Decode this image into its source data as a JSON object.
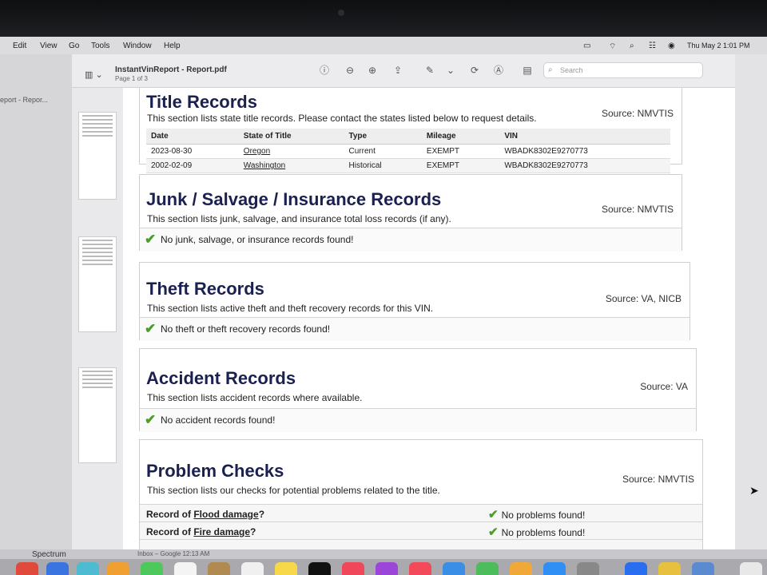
{
  "menubar": {
    "menus": [
      "Edit",
      "View",
      "Go",
      "Tools",
      "Window",
      "Help"
    ],
    "clock": "Thu May 2  1:01 PM"
  },
  "window": {
    "doc_title": "InstantVinReport - Report.pdf",
    "page_indicator": "Page 1 of 3",
    "search_placeholder": "Search",
    "thumb_label": "eport - Repor..."
  },
  "report": {
    "title_records": {
      "title": "Title Records",
      "description": "This section lists state title records. Please contact the states listed below to request details.",
      "source": "Source: NMVTIS",
      "columns": [
        "Date",
        "State of Title",
        "Type",
        "Mileage",
        "VIN"
      ],
      "rows": [
        [
          "2023-08-30",
          "Oregon",
          "Current",
          "EXEMPT",
          "WBADK8302E9270773"
        ],
        [
          "2002-02-09",
          "Washington",
          "Historical",
          "EXEMPT",
          "WBADK8302E9270773"
        ]
      ]
    },
    "junk_salvage": {
      "title": "Junk / Salvage / Insurance Records",
      "description": "This section lists junk, salvage, and insurance total loss records (if any).",
      "source": "Source: NMVTIS",
      "result": "No junk, salvage, or insurance records found!"
    },
    "theft": {
      "title": "Theft Records",
      "description": "This section lists active theft and theft recovery records for this VIN.",
      "source": "Source: VA, NICB",
      "result": "No theft or theft recovery records found!"
    },
    "accident": {
      "title": "Accident Records",
      "description": "This section lists accident records where available.",
      "source": "Source: VA",
      "result": "No accident records found!"
    },
    "problem_checks": {
      "title": "Problem Checks",
      "description": "This section lists our checks for potential problems related to the title.",
      "source": "Source: NMVTIS",
      "rows": [
        {
          "prefix": "Record of ",
          "topic": "Flood damage",
          "suffix": "?",
          "result": "No problems found!"
        },
        {
          "prefix": "Record of ",
          "topic": "Fire damage",
          "suffix": "?",
          "result": "No problems found!"
        }
      ]
    }
  },
  "bottom": {
    "spectrum": "Spectrum",
    "inbox": "Inbox – Google   12:13 AM"
  },
  "colors": {
    "heading": "#1a2050",
    "check": "#4c9d2a"
  }
}
